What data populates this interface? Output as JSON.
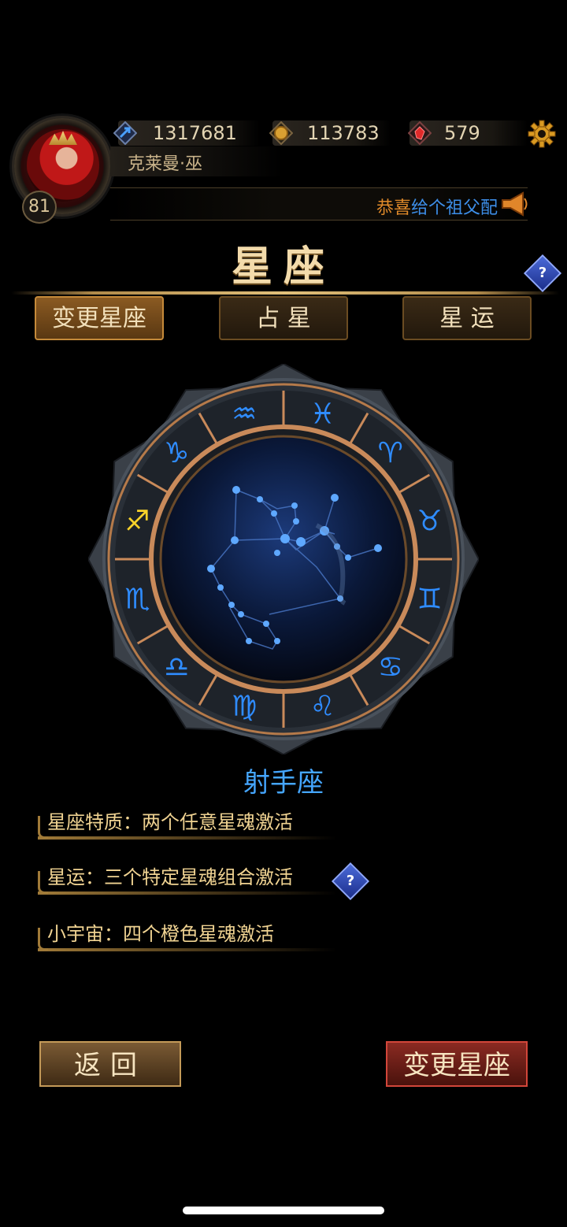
{
  "player": {
    "name": "克莱曼·巫",
    "level": "81"
  },
  "resources": {
    "power": "1317681",
    "gold": "113783",
    "gems": "579"
  },
  "ticker": {
    "part1": "恭喜",
    "part2": "给个祖父配"
  },
  "title": "星座",
  "tabs": [
    {
      "label": "变更星座",
      "active": true
    },
    {
      "label": "占 星",
      "active": false
    },
    {
      "label": "星 运",
      "active": false
    }
  ],
  "wheel": {
    "signs": [
      "♓",
      "♈",
      "♉",
      "♊",
      "♋",
      "♌",
      "♍",
      "♎",
      "♏",
      "♐",
      "♑",
      "♒"
    ],
    "selected": "♐"
  },
  "sign_name": "射手座",
  "traits": [
    "星座特质：两个任意星魂激活",
    "星运：三个特定星魂组合激活",
    "小宇宙：四个橙色星魂激活"
  ],
  "help_label": "?",
  "buttons": {
    "back": "返回",
    "change": "变更星座"
  },
  "colors": {
    "accent_gold": "#f0d392",
    "accent_blue": "#45a6ff",
    "selected_sign": "#f7d22a"
  }
}
